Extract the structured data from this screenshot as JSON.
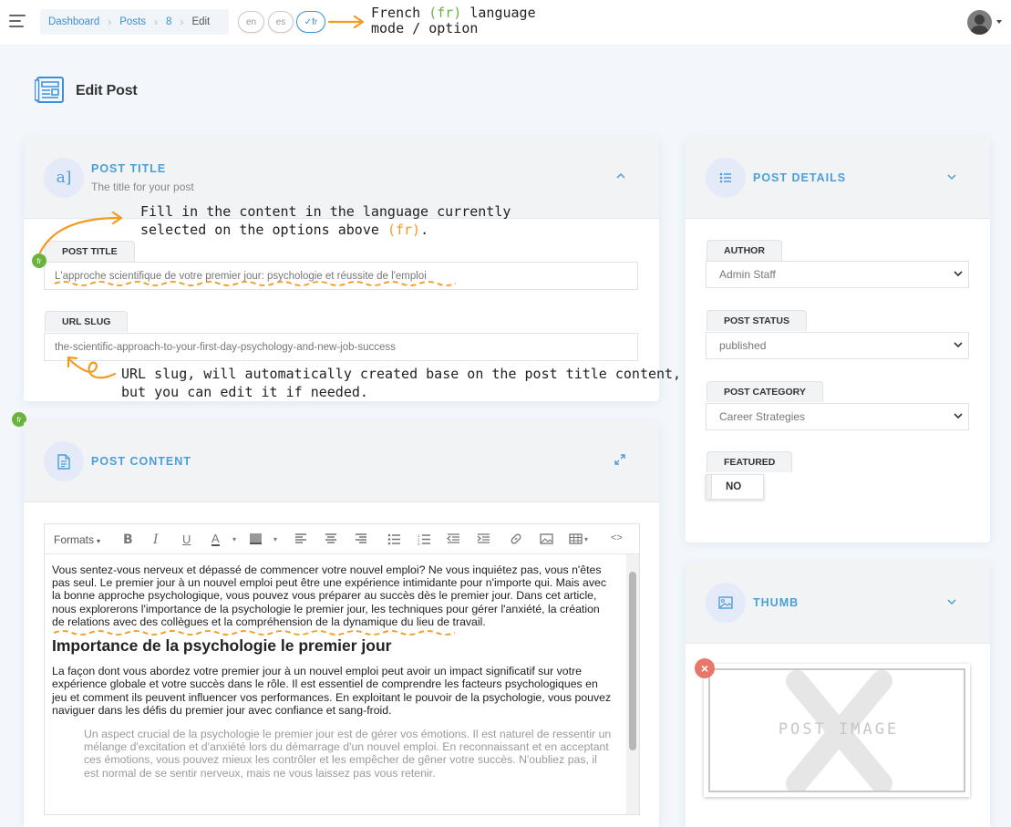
{
  "breadcrumb": {
    "items": [
      "Dashboard",
      "Posts",
      "8"
    ],
    "current": "Edit"
  },
  "languages": [
    {
      "code": "en",
      "active": false
    },
    {
      "code": "es",
      "active": false
    },
    {
      "code": "✓fr",
      "active": true
    }
  ],
  "annotations": {
    "lang_part1": "French ",
    "lang_code": "(fr)",
    "lang_part2": " language",
    "lang_line2": "mode / option",
    "content_line1": "Fill in the content in the language currently",
    "content_line2a": "selected on the options above ",
    "content_line2b": "(fr)",
    "content_line2c": ".",
    "slug_line1": "URL slug, will automatically created base on the post title content,",
    "slug_line2": "but you can edit it if needed."
  },
  "page": {
    "title": "Edit Post"
  },
  "post_title_card": {
    "title": "POST TITLE",
    "subtitle": "The title for your post",
    "icon_glyph": "a]",
    "fields": {
      "title_label": "POST TITLE",
      "title_value": "L'approche scientifique de votre premier jour: psychologie et réussite de l'emploi",
      "slug_label": "URL SLUG",
      "slug_value": "the-scientific-approach-to-your-first-day-psychology-and-new-job-success"
    },
    "lang_badge": "fr"
  },
  "post_content_card": {
    "title": "POST CONTENT",
    "lang_badge": "fr",
    "toolbar": {
      "formats_label": "Formats"
    },
    "content": {
      "p1": "Vous sentez-vous nerveux et dépassé de commencer votre nouvel emploi? Ne vous inquiétez pas, vous n'êtes pas seul. Le premier jour à un nouvel emploi peut être une expérience intimidante pour n'importe qui. Mais avec la bonne approche psychologique, vous pouvez vous préparer au succès dès le premier jour. Dans cet article, nous explorerons l'importance de la psychologie le premier jour, les techniques pour gérer l'anxiété, la création de relations avec des collègues et la compréhension de la dynamique du lieu de travail.",
      "h2": "Importance de la psychologie le premier jour",
      "p2": "La façon dont vous abordez votre premier jour à un nouvel emploi peut avoir un impact significatif sur votre expérience globale et votre succès dans le rôle. Il est essentiel de comprendre les facteurs psychologiques en jeu et comment ils peuvent influencer vos performances. En exploitant le pouvoir de la psychologie, vous pouvez naviguer dans les défis du premier jour avec confiance et sang-froid.",
      "quote": "Un aspect crucial de la psychologie le premier jour est de gérer vos émotions. Il est naturel de ressentir un mélange d'excitation et d'anxiété lors du démarrage d'un nouvel emploi. En reconnaissant et en acceptant ces émotions, vous pouvez mieux les contrôler et les empêcher de gêner votre succès. N'oubliez pas, il est normal de se sentir nerveux, mais ne vous laissez pas vous retenir."
    }
  },
  "post_details_card": {
    "title": "POST DETAILS",
    "author_label": "AUTHOR",
    "author_value": "Admin Staff",
    "status_label": "POST STATUS",
    "status_value": "published",
    "category_label": "POST CATEGORY",
    "category_value": "Career Strategies",
    "featured_label": "FEATURED",
    "featured_value": "NO"
  },
  "thumb_card": {
    "title": "THUMB",
    "placeholder_text": "POST IMAGE",
    "remove_glyph": "×"
  },
  "colors": {
    "accent_blue": "#4b9ed8",
    "french_green": "#6ab43e",
    "annotation_orange": "#f59a21"
  }
}
